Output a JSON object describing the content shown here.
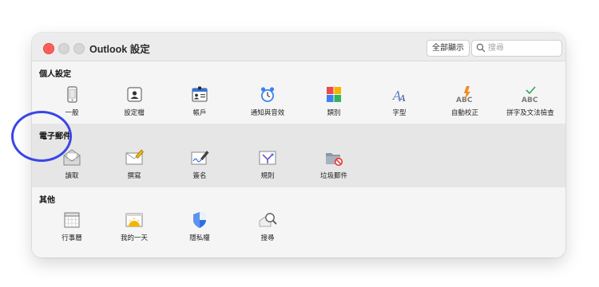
{
  "window": {
    "title": "Outlook 設定",
    "show_all_label": "全部顯示",
    "search_placeholder": "搜尋"
  },
  "sections": [
    {
      "title": "個人設定",
      "items": [
        {
          "label": "一般",
          "icon": "phone-general-icon"
        },
        {
          "label": "設定檔",
          "icon": "profile-card-icon"
        },
        {
          "label": "帳戶",
          "icon": "accounts-icon"
        },
        {
          "label": "通知與音效",
          "icon": "alarm-clock-icon"
        },
        {
          "label": "類別",
          "icon": "color-categories-icon"
        },
        {
          "label": "字型",
          "icon": "font-icon"
        },
        {
          "label": "自動校正",
          "icon": "autocorrect-icon"
        },
        {
          "label": "拼字及文法檢查",
          "icon": "spelling-grammar-icon"
        }
      ]
    },
    {
      "title": "電子郵件",
      "items": [
        {
          "label": "讀取",
          "icon": "envelope-reading-icon"
        },
        {
          "label": "撰寫",
          "icon": "compose-pencil-icon"
        },
        {
          "label": "簽名",
          "icon": "signature-icon"
        },
        {
          "label": "規則",
          "icon": "rules-icon"
        },
        {
          "label": "垃圾郵件",
          "icon": "junk-folder-icon"
        }
      ]
    },
    {
      "title": "其他",
      "items": [
        {
          "label": "行事曆",
          "icon": "calendar-icon"
        },
        {
          "label": "我的一天",
          "icon": "my-day-icon"
        },
        {
          "label": "隱私權",
          "icon": "privacy-shield-icon"
        },
        {
          "label": "搜尋",
          "icon": "search-magnifier-icon"
        }
      ]
    }
  ],
  "colors": {
    "close_button": "#ff5f57",
    "highlight_ring": "#3a46e6",
    "accent_blue": "#3473d9"
  }
}
